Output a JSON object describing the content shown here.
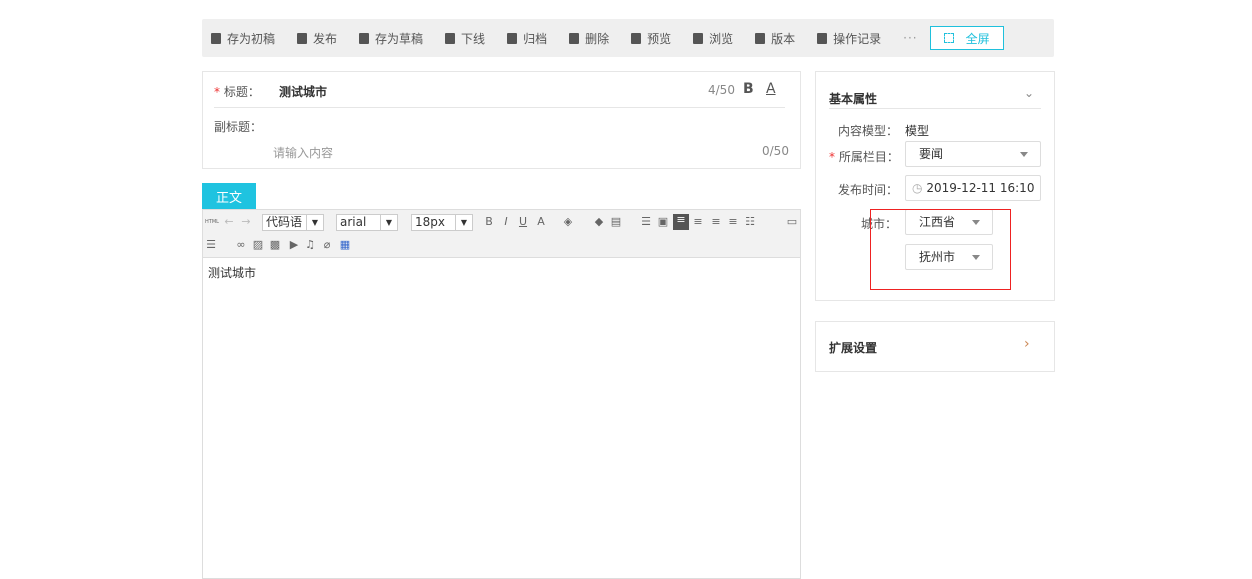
{
  "toolbar": {
    "items": [
      {
        "label": "存为初稿",
        "icon": "save-icon"
      },
      {
        "label": "发布",
        "icon": "send-icon"
      },
      {
        "label": "存为草稿",
        "icon": "draft-icon"
      },
      {
        "label": "下线",
        "icon": "arrow-down-icon"
      },
      {
        "label": "归档",
        "icon": "archive-icon"
      },
      {
        "label": "删除",
        "icon": "trash-icon"
      },
      {
        "label": "预览",
        "icon": "preview-icon"
      },
      {
        "label": "浏览",
        "icon": "eye-icon"
      },
      {
        "label": "版本",
        "icon": "book-icon"
      },
      {
        "label": "操作记录",
        "icon": "log-icon"
      }
    ],
    "more": "···",
    "fullscreen": "全屏"
  },
  "title": {
    "label": "标题：",
    "value": "测试城市",
    "count": "4/50",
    "bold": "B",
    "font": "A"
  },
  "subtitle": {
    "label": "副标题：",
    "placeholder": "请输入内容",
    "count": "0/50"
  },
  "tab": "正文",
  "editor": {
    "html": "HTML",
    "block": "代码语",
    "font": "arial",
    "size": "18px",
    "content": "测试城市"
  },
  "panel": {
    "title": "基本属性",
    "model_label": "内容模型：",
    "model_value": "模型",
    "column_label": "所属栏目：",
    "column_value": "要闻",
    "time_label": "发布时间：",
    "time_value": "2019-12-11 16:10",
    "city_label": "城市：",
    "province": "江西省",
    "city": "抚州市"
  },
  "ext": {
    "title": "扩展设置"
  }
}
